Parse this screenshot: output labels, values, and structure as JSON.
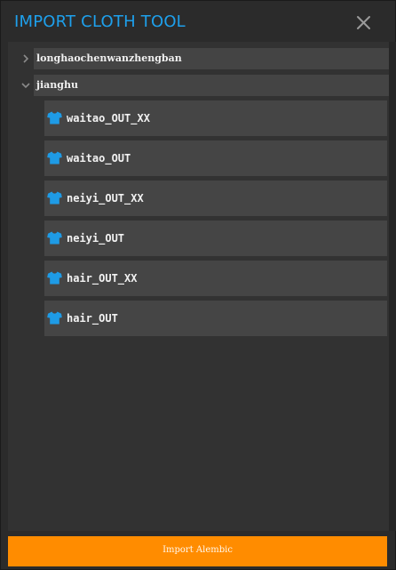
{
  "window": {
    "title": "IMPORT CLOTH TOOL",
    "close_icon": "close-x-icon"
  },
  "colors": {
    "title": "#1ea0ec",
    "accent_button": "#ff8c00",
    "shirt_icon": "#1e9be6",
    "background": "#2b2b2b",
    "panel": "#323232",
    "row": "#454545"
  },
  "tree": {
    "groups": [
      {
        "label": "longhaochenwanzhengban",
        "expanded": false,
        "arrow_icon": "chevron-right-icon"
      },
      {
        "label": "jianghu",
        "expanded": true,
        "arrow_icon": "chevron-down-icon",
        "items": [
          {
            "label": "waitao_OUT_XX",
            "icon": "shirt-icon"
          },
          {
            "label": "waitao_OUT",
            "icon": "shirt-icon"
          },
          {
            "label": "neiyi_OUT_XX",
            "icon": "shirt-icon"
          },
          {
            "label": "neiyi_OUT",
            "icon": "shirt-icon"
          },
          {
            "label": "hair_OUT_XX",
            "icon": "shirt-icon"
          },
          {
            "label": "hair_OUT",
            "icon": "shirt-icon"
          }
        ]
      }
    ]
  },
  "footer": {
    "import_label": "Import Alembic"
  }
}
